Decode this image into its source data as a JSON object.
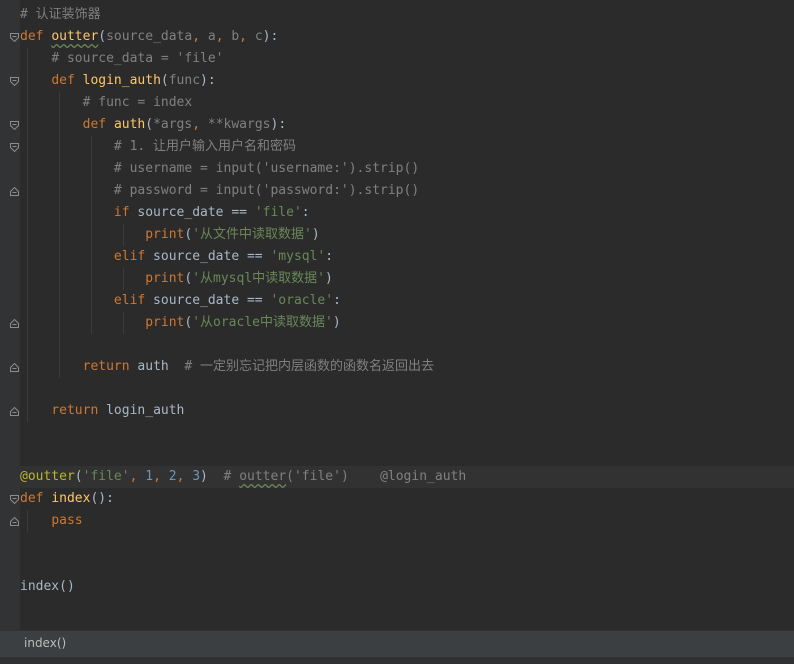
{
  "code": {
    "l1": "# 认证装饰器",
    "l2": {
      "kw": "def",
      "name": "outter",
      "open": "(",
      "p1": "source_data",
      "c1": ", ",
      "p2": "a",
      "c2": ", ",
      "p3": "b",
      "c3": ", ",
      "p4": "c",
      "close": "):"
    },
    "l3": "# source_data = 'file'",
    "l4": {
      "kw": "def",
      "name": "login_auth",
      "open": "(",
      "p1": "func",
      "close": "):"
    },
    "l5": "# func = index",
    "l6": {
      "kw": "def",
      "name": "auth",
      "open": "(",
      "s1": "*",
      "p1": "args",
      "c1": ", ",
      "s2": "**",
      "p2": "kwargs",
      "close": "):"
    },
    "l7": "# 1. 让用户输入用户名和密码",
    "l8": "# username = input('username:').strip()",
    "l9": "# password = input('password:').strip()",
    "l10": {
      "kw": "if",
      "expr": " source_date == ",
      "str": "'file'",
      "end": ":"
    },
    "l11": {
      "fn": "print",
      "open": "(",
      "str": "'从文件中读取数据'",
      "close": ")"
    },
    "l12": {
      "kw": "elif",
      "expr": " source_date == ",
      "str": "'mysql'",
      "end": ":"
    },
    "l13": {
      "fn": "print",
      "open": "(",
      "str": "'从mysql中读取数据'",
      "close": ")"
    },
    "l14": {
      "kw": "elif",
      "expr": " source_date == ",
      "str": "'oracle'",
      "end": ":"
    },
    "l15": {
      "fn": "print",
      "open": "(",
      "str": "'从oracle中读取数据'",
      "close": ")"
    },
    "l17": {
      "kw": "return",
      "val": " auth  ",
      "comment": "# 一定别忘记把内层函数的函数名返回出去"
    },
    "l19": {
      "kw": "return",
      "val": " login_auth"
    },
    "l22": {
      "at": "@",
      "name": "outter",
      "open": "(",
      "s1": "'file'",
      "c1": ", ",
      "n1": "1",
      "c2": ", ",
      "n2": "2",
      "c3": ", ",
      "n3": "3",
      "close": ")  ",
      "cm1": "# ",
      "cm2": "outter",
      "cm3": "('file')    @login_auth"
    },
    "l23": {
      "kw": "def",
      "name": "index",
      "close": "():"
    },
    "l24": {
      "kw": "pass"
    },
    "l27": "index()"
  },
  "status": {
    "breadcrumb": "index()"
  }
}
